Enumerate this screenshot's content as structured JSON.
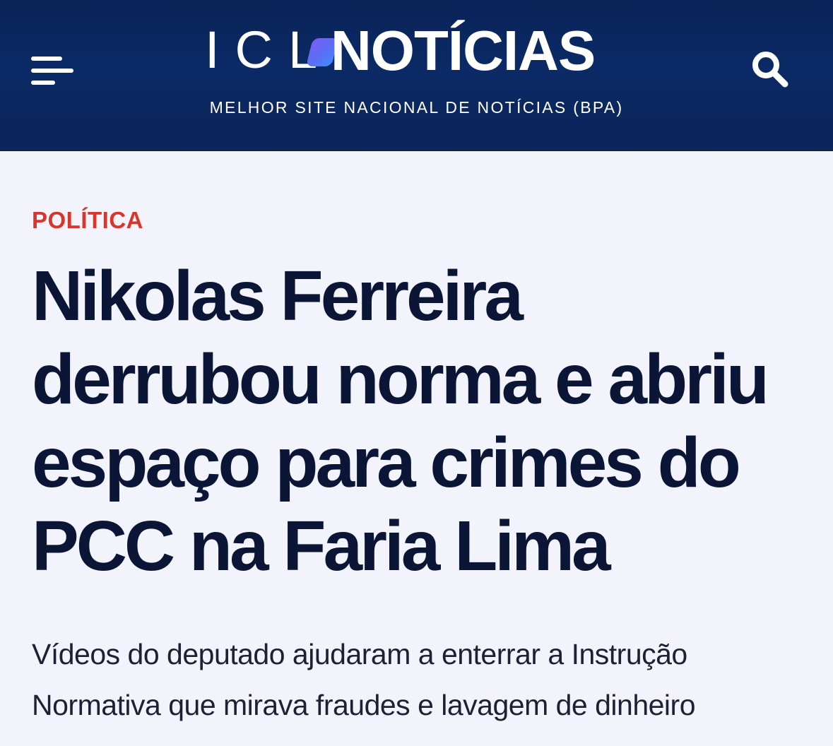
{
  "header": {
    "logo": {
      "prefix": "ICL",
      "name": "NOTÍCIAS"
    },
    "tagline": "MELHOR SITE NACIONAL DE NOTÍCIAS (BPA)",
    "menu_icon": "hamburger-menu-icon",
    "search_icon": "search-icon",
    "colors": {
      "background": "#0b2a66",
      "logo_mark": "#5a6ff5",
      "text": "#ffffff"
    }
  },
  "article": {
    "category": "POLÍTICA",
    "headline": "Nikolas Ferreira derrubou norma e abriu espaço para crimes do PCC na Faria Lima",
    "subtitle": "Vídeos do deputado ajudaram a enterrar a Instrução Normativa que mirava fraudes e lavagem de dinheiro",
    "colors": {
      "category": "#d9352a",
      "headline": "#0b1636",
      "page_background": "#f3f4fb"
    }
  }
}
